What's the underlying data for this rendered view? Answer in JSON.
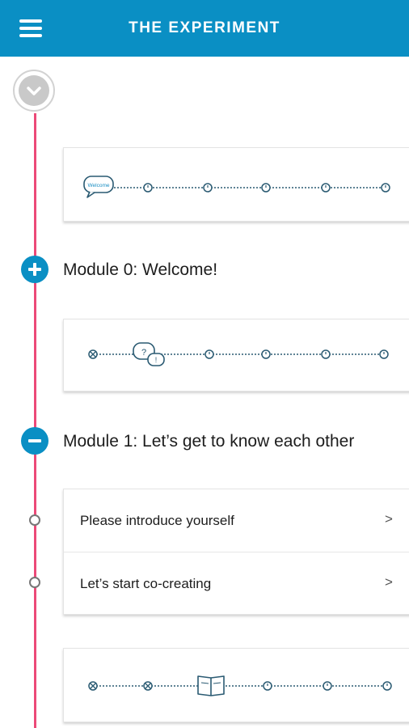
{
  "header": {
    "title": "THE EXPERIMENT",
    "menu_icon": "hamburger-menu-icon"
  },
  "timeline": {
    "accent_color": "#ec4a78",
    "top_node_icon": "chevron-down-icon"
  },
  "colors": {
    "brand": "#0a8fc4",
    "timeline": "#ec4a78"
  },
  "cards": [
    {
      "name": "intro-progress",
      "badge_text": "Welcome",
      "icons": [
        "speech-bubble",
        "clock",
        "clock",
        "clock",
        "clock",
        "clock"
      ]
    },
    {
      "name": "module-0-progress",
      "icons": [
        "check-circle",
        "question-chat-bubbles",
        "clock",
        "clock",
        "clock",
        "clock"
      ]
    },
    {
      "name": "module-1-progress",
      "icons": [
        "check-circle",
        "check-circle",
        "open-book",
        "clock",
        "clock",
        "clock"
      ]
    }
  ],
  "modules": [
    {
      "title": "Module 0: Welcome!",
      "state": "collapsed",
      "toggle_icon": "plus-icon"
    },
    {
      "title": "Module 1: Let’s get to know each other",
      "state": "expanded",
      "toggle_icon": "minus-icon",
      "items": [
        {
          "label": "Please introduce yourself",
          "chevron": ">"
        },
        {
          "label": "Let’s start co-creating",
          "chevron": ">"
        }
      ]
    }
  ]
}
